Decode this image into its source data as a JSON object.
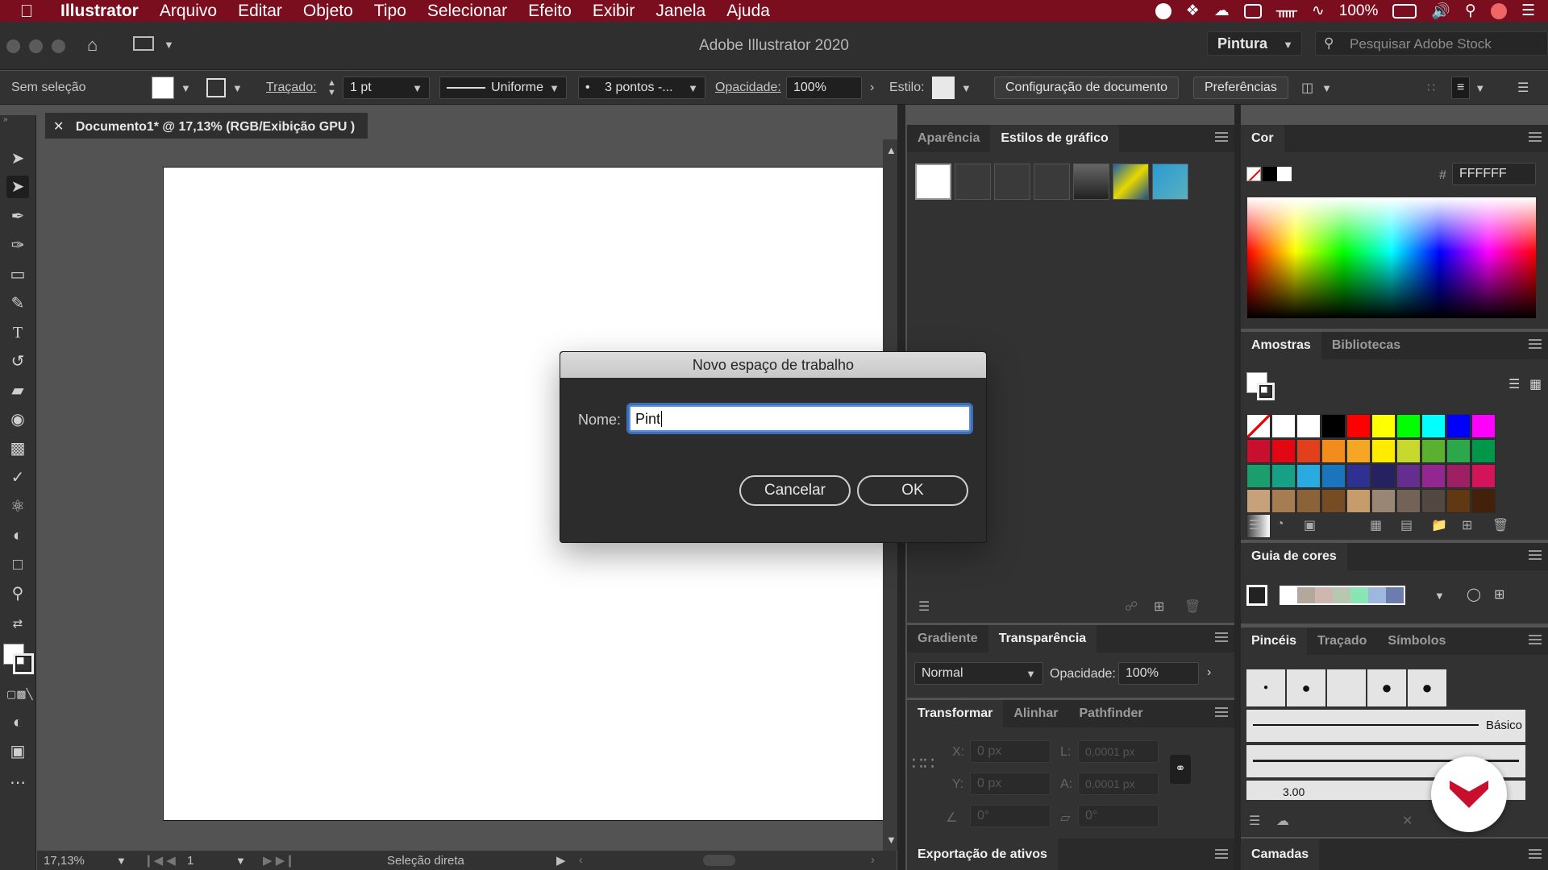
{
  "menubar": {
    "app_name": "Illustrator",
    "items": [
      "Arquivo",
      "Editar",
      "Objeto",
      "Tipo",
      "Selecionar",
      "Efeito",
      "Exibir",
      "Janela",
      "Ajuda"
    ],
    "battery": "100%",
    "bg_color": "#7a0d1e"
  },
  "appbar": {
    "title": "Adobe Illustrator 2020",
    "workspace": "Pintura",
    "search_placeholder": "Pesquisar Adobe Stock"
  },
  "controlbar": {
    "selection": "Sem seleção",
    "stroke_label": "Traçado:",
    "stroke_value": "1 pt",
    "profile": "Uniforme",
    "brush": "3 pontos -...",
    "opacity_label": "Opacidade:",
    "opacity_value": "100%",
    "style_label": "Estilo:",
    "doc_setup": "Configuração de documento",
    "prefs": "Preferências"
  },
  "document": {
    "tab_title": "Documento1* @ 17,13% (RGB/Exibição GPU )",
    "zoom": "17,13%",
    "page": "1",
    "tool_status": "Seleção direta"
  },
  "panels": {
    "appearance_tab": "Aparência",
    "graphic_styles_tab": "Estilos de gráfico",
    "gradient_tab": "Gradiente",
    "transparency_tab": "Transparência",
    "blend_mode": "Normal",
    "opacity_label": "Opacidade:",
    "opacity_value": "100%",
    "transform_tab": "Transformar",
    "align_tab": "Alinhar",
    "pathfinder_tab": "Pathfinder",
    "x_label": "X:",
    "y_label": "Y:",
    "l_label": "L:",
    "a_label": "A:",
    "x_value": "0 px",
    "y_value": "0 px",
    "l_value": "0,0001 px",
    "a_value": "0,0001 px",
    "angle_value": "0°",
    "shear_value": "0°",
    "export_tab": "Exportação de ativos",
    "color_tab": "Cor",
    "hex_label": "#",
    "hex_value": "FFFFFF",
    "swatches_tab": "Amostras",
    "libraries_tab": "Bibliotecas",
    "color_guide_tab": "Guia de cores",
    "brushes_tab": "Pincéis",
    "stroke_tab": "Traçado",
    "symbols_tab": "Símbolos",
    "brush_basic": "Básico",
    "brush_size": "3.00",
    "layers_tab": "Camadas"
  },
  "dialog": {
    "title": "Novo espaço de trabalho",
    "name_label": "Nome:",
    "name_value": "Pint",
    "cancel": "Cancelar",
    "ok": "OK"
  },
  "swatch_colors": [
    "#000000",
    "#ff0000",
    "#ffff00",
    "#00ff00",
    "#00ffff",
    "#0000ff",
    "#ff00ff",
    "#c8102e",
    "#e30613",
    "#e2401c",
    "#f28c1c",
    "#f5a623",
    "#ffeb00",
    "#c7d92c",
    "#5cb030",
    "#2aa84a",
    "#00974a",
    "#1b9e6e",
    "#16a085",
    "#29abe2",
    "#1b75bc",
    "#2e3192",
    "#262262",
    "#662d91",
    "#92278f",
    "#9e1f63",
    "#d4145a",
    "#c7a17a",
    "#a67c52",
    "#8c6239",
    "#754c24",
    "#c69c6d",
    "#998675",
    "#736357",
    "#534741",
    "#603913",
    "#42210b",
    "#e0e0e0"
  ],
  "color_guide_colors": [
    "#b4a79b",
    "#d0b6b0",
    "#b8c7b0",
    "#8ae5b5",
    "#9db7de",
    "#6d7caf"
  ]
}
